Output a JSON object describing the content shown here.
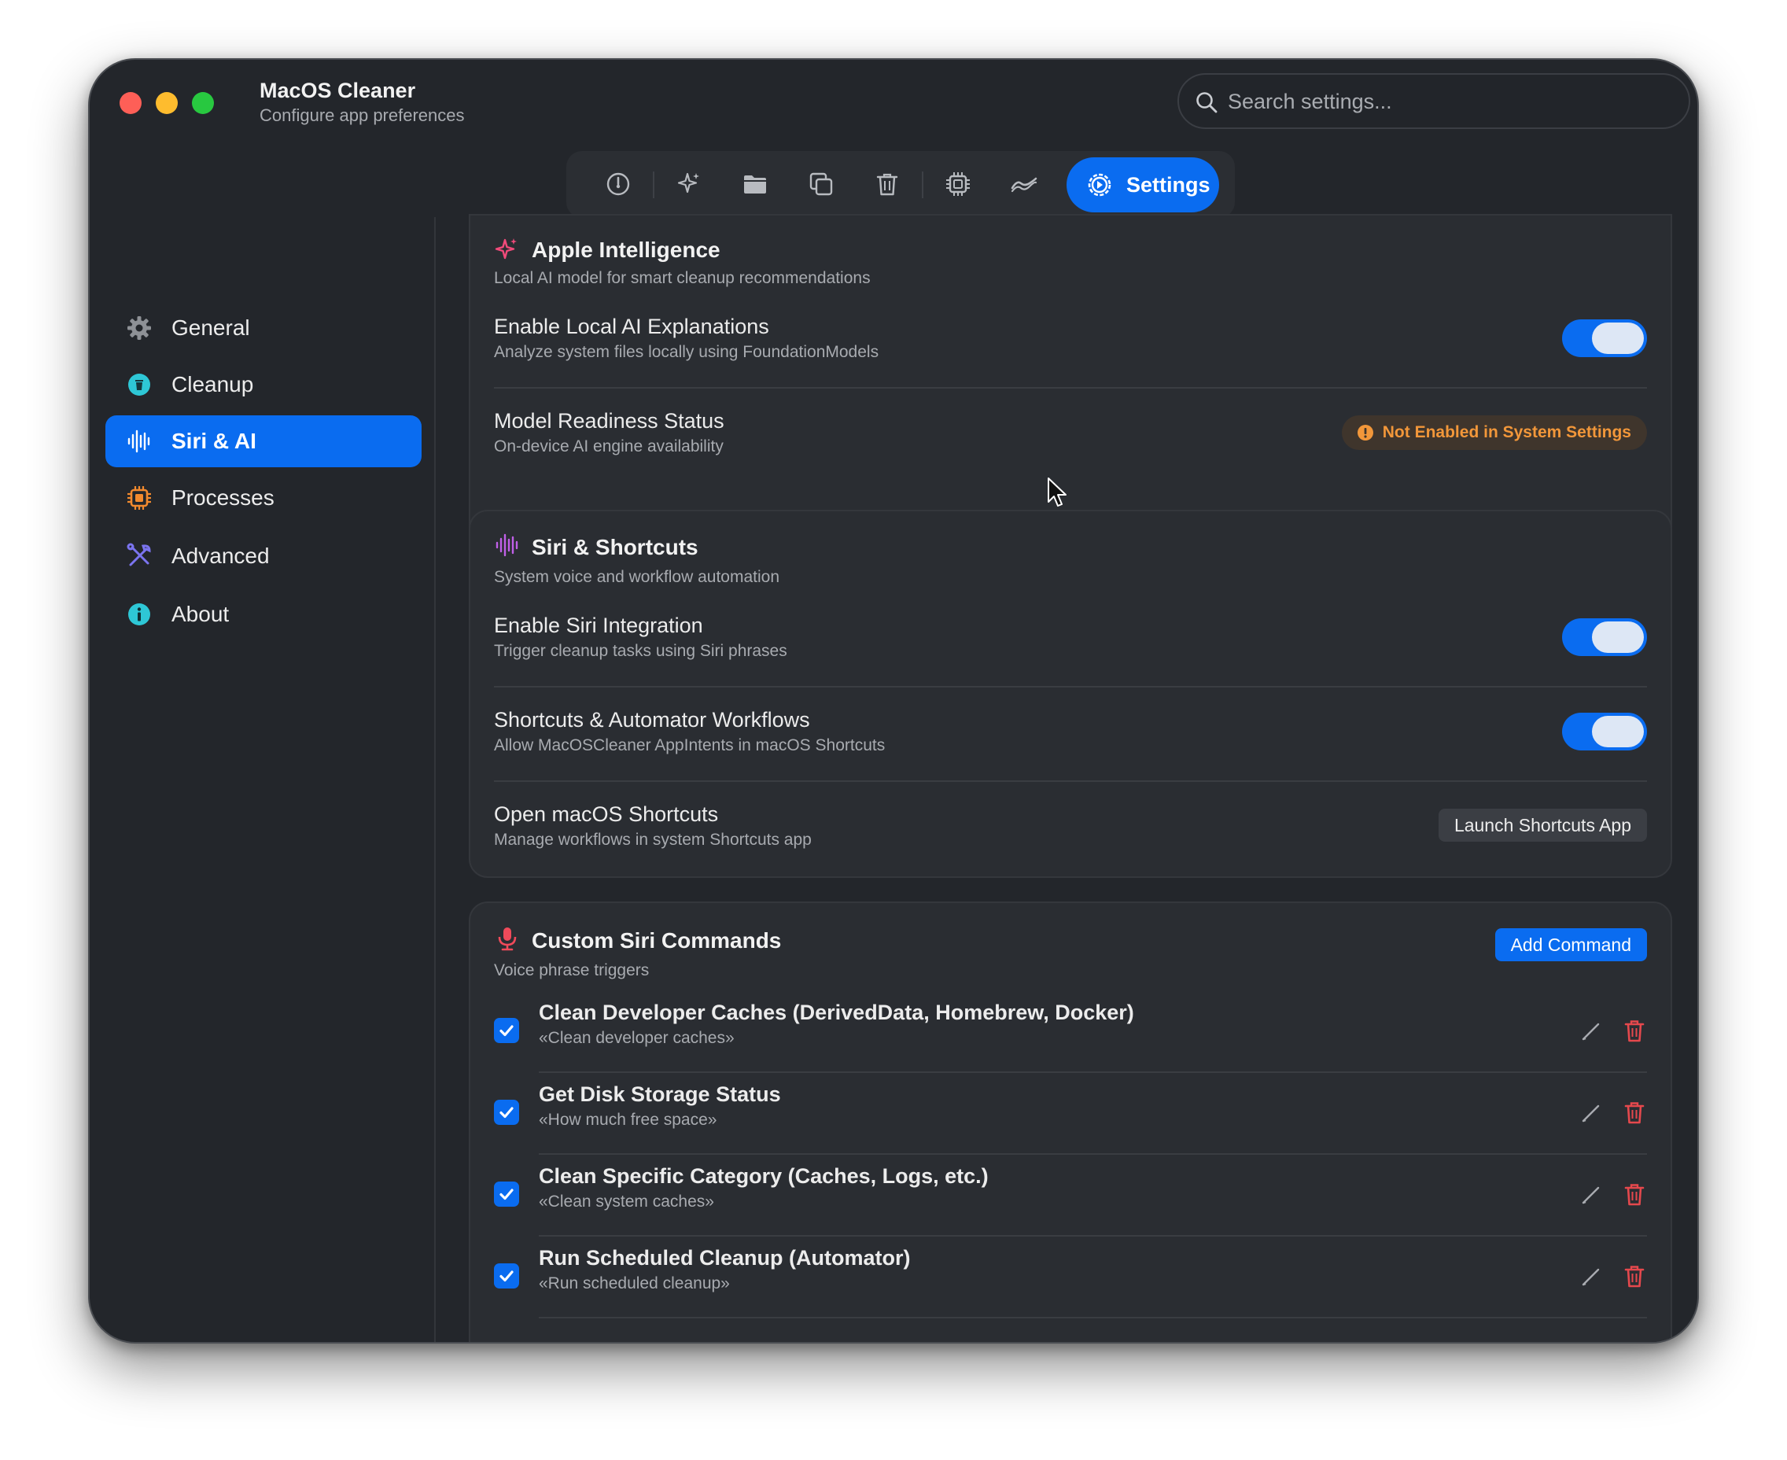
{
  "window": {
    "title": "MacOS Cleaner",
    "subtitle": "Configure app preferences"
  },
  "search": {
    "placeholder": "Search settings..."
  },
  "toolbar": {
    "icons": [
      "gauge-icon",
      "sparkles-icon",
      "folder-icon",
      "duplicate-icon",
      "trash-icon",
      "cpu-icon",
      "activity-icon"
    ],
    "active_label": "Settings"
  },
  "sidebar": {
    "items": [
      {
        "label": "General",
        "icon": "gear-icon",
        "color": "#8e9196"
      },
      {
        "label": "Cleanup",
        "icon": "trash-circle-icon",
        "color": "#2ec7d6"
      },
      {
        "label": "Siri & AI",
        "icon": "waveform-icon",
        "color": "#ffffff",
        "active": true
      },
      {
        "label": "Processes",
        "icon": "cpu-icon",
        "color": "#f28a2e"
      },
      {
        "label": "Advanced",
        "icon": "tools-icon",
        "color": "#7b74f0"
      },
      {
        "label": "About",
        "icon": "info-icon",
        "color": "#2ec7d6"
      }
    ]
  },
  "apple_intelligence": {
    "title": "Apple Intelligence",
    "description": "Local AI model for smart cleanup recommendations",
    "rows": [
      {
        "title": "Enable Local AI Explanations",
        "subtitle": "Analyze system files locally using FoundationModels",
        "enabled": true
      },
      {
        "title": "Model Readiness Status",
        "subtitle": "On-device AI engine availability",
        "status": "Not Enabled in System Settings"
      }
    ]
  },
  "siri_shortcuts": {
    "title": "Siri & Shortcuts",
    "description": "System voice and workflow automation",
    "rows": [
      {
        "title": "Enable Siri Integration",
        "subtitle": "Trigger cleanup tasks using Siri phrases",
        "enabled": true
      },
      {
        "title": "Shortcuts & Automator Workflows",
        "subtitle": "Allow MacOSCleaner AppIntents in macOS Shortcuts",
        "enabled": true
      },
      {
        "title": "Open macOS Shortcuts",
        "subtitle": "Manage workflows in system Shortcuts app",
        "button": "Launch Shortcuts App"
      }
    ]
  },
  "custom_commands": {
    "title": "Custom Siri Commands",
    "description": "Voice phrase triggers",
    "add_label": "Add Command",
    "commands": [
      {
        "title": "Clean Developer Caches (DerivedData, Homebrew, Docker)",
        "phrase": "«Clean developer caches»",
        "checked": true
      },
      {
        "title": "Get Disk Storage Status",
        "phrase": "«How much free space»",
        "checked": true
      },
      {
        "title": "Clean Specific Category (Caches, Logs, etc.)",
        "phrase": "«Clean system caches»",
        "checked": true
      },
      {
        "title": "Run Scheduled Cleanup (Automator)",
        "phrase": "«Run scheduled cleanup»",
        "checked": true
      }
    ]
  },
  "colors": {
    "accent": "#0a6cf0",
    "warning": "#f2973a",
    "danger": "#e5484d",
    "background": "#23262b",
    "card": "#2a2d32"
  }
}
